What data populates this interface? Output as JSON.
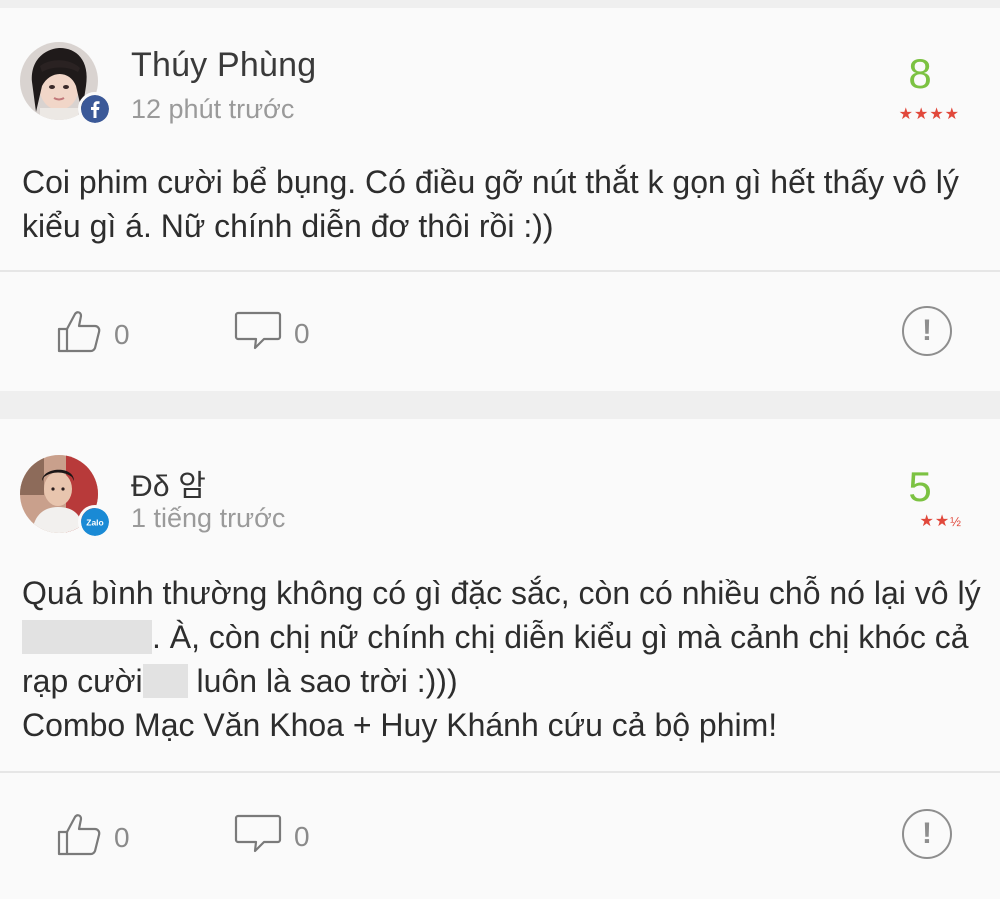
{
  "reviews": [
    {
      "user_name": "Thúy Phùng",
      "time_ago": "12 phút trước",
      "source": "facebook",
      "source_icon": "facebook-icon",
      "score": "8",
      "stars": "★★★★",
      "text": "Coi phim cười bể bụng. Có điều gỡ nút thắt k gọn gì hết thấy vô lý kiểu gì á. Nữ chính diễn đơ thôi rồi :))",
      "like_count": "0",
      "comment_count": "0"
    },
    {
      "user_name": "Đδ 암",
      "time_ago": "1 tiếng trước",
      "source": "zalo",
      "source_icon": "zalo-icon",
      "source_label": "Zalo",
      "score": "5",
      "stars": "★★",
      "stars_half": "½",
      "text_line1_a": "Quá bình thường không có gì đặc sắc, còn có nhiều chỗ nó lại vô lý",
      "text_line1_b": ". À, còn chị nữ chính chị diễn kiểu gì mà cảnh chị khóc cả rạp cười",
      "text_line1_c": " luôn là sao trời :)))",
      "text_line2": "Combo Mạc Văn Khoa + Huy Khánh cứu cả bộ phim!",
      "like_count": "0",
      "comment_count": "0"
    }
  ],
  "colors": {
    "score": "#7cc242",
    "stars": "#e1483b",
    "facebook": "#3b5998",
    "zalo": "#1a8ad5"
  },
  "report_symbol": "!"
}
